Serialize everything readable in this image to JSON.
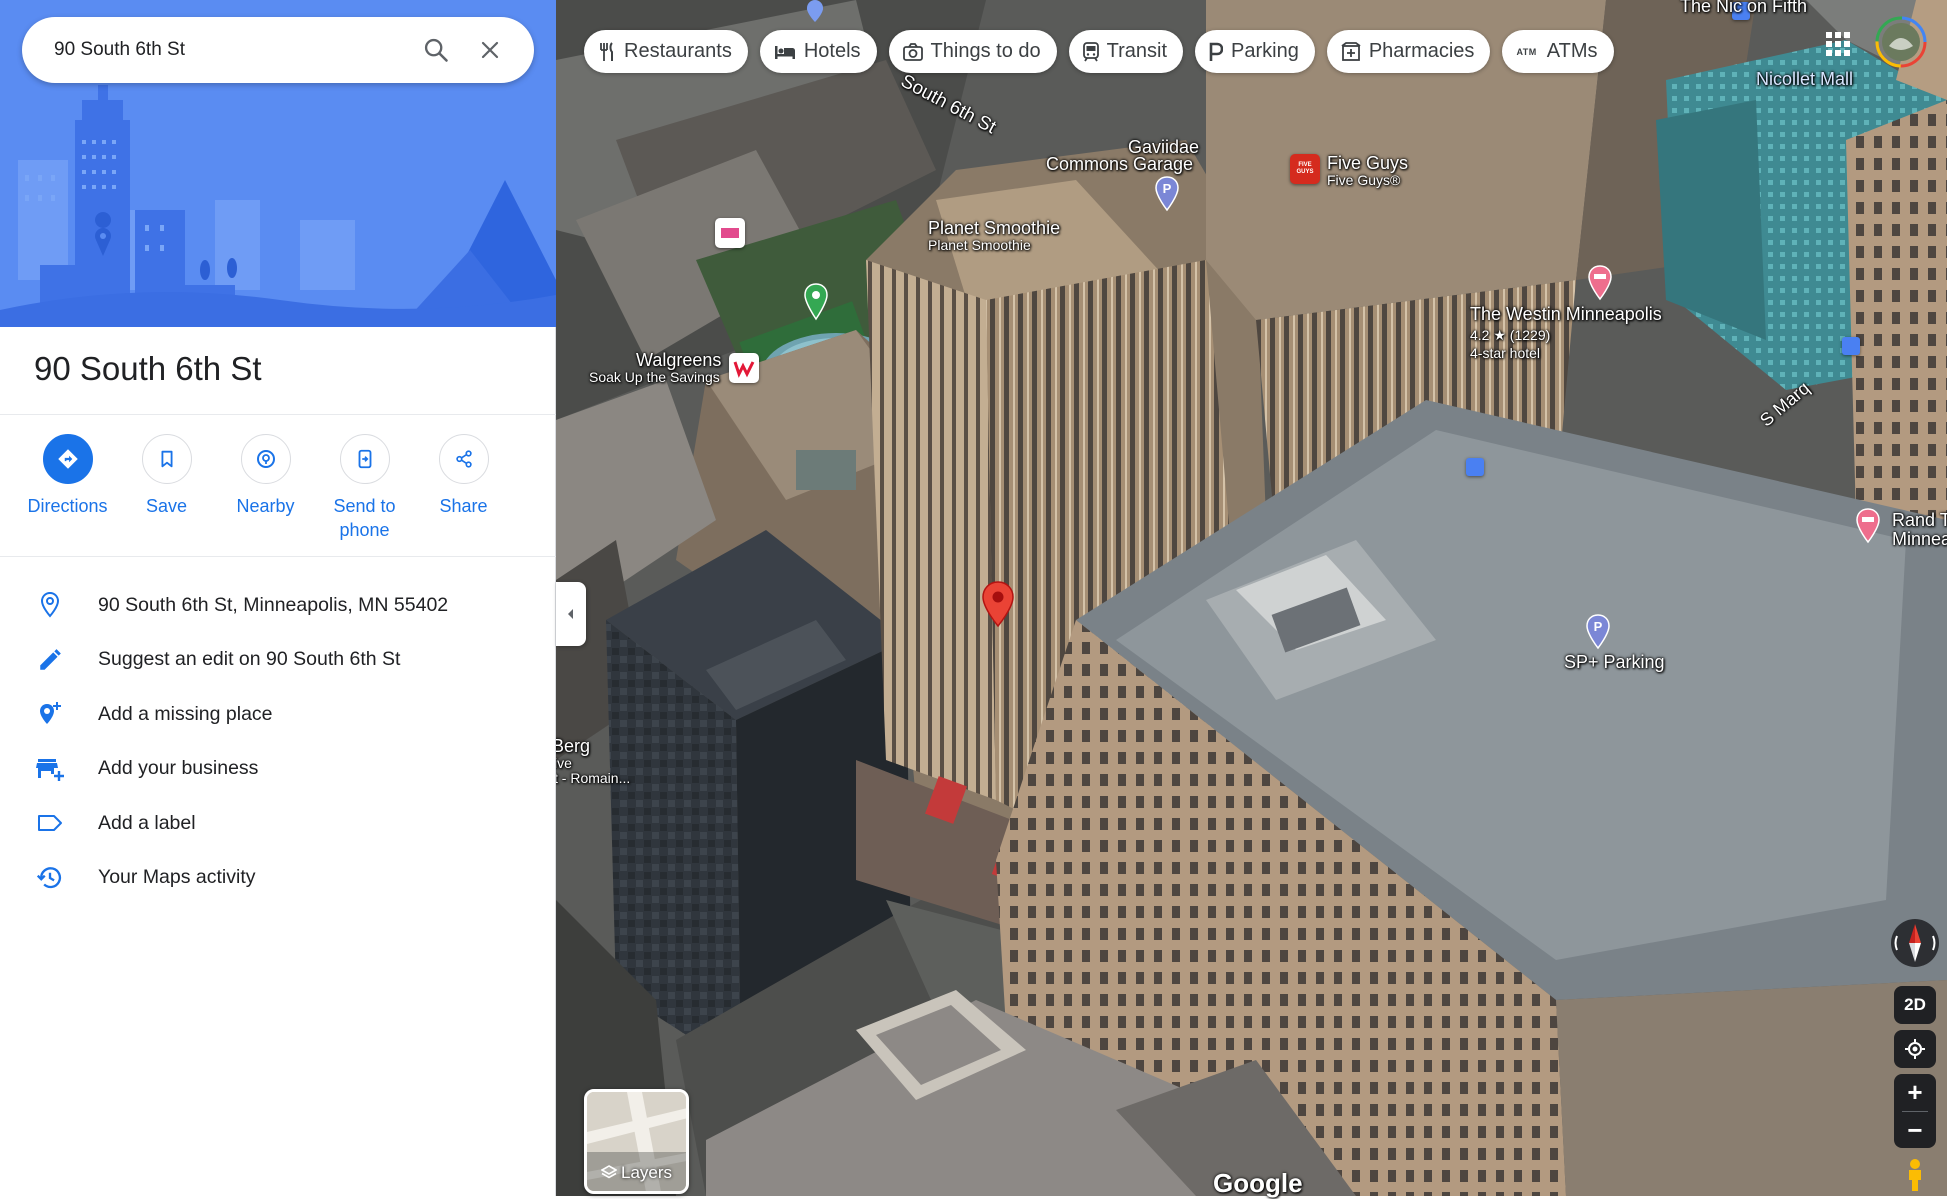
{
  "search": {
    "value": "90 South 6th St"
  },
  "place": {
    "title": "90 South 6th St"
  },
  "actions": [
    {
      "label": "Directions"
    },
    {
      "label": "Save"
    },
    {
      "label": "Nearby"
    },
    {
      "label": "Send to phone"
    },
    {
      "label": "Share"
    }
  ],
  "info": [
    {
      "text": "90 South 6th St, Minneapolis, MN 55402",
      "icon": "location-pin-icon"
    },
    {
      "text": "Suggest an edit on 90 South 6th St",
      "icon": "pencil-icon"
    },
    {
      "text": "Add a missing place",
      "icon": "add-place-icon"
    },
    {
      "text": "Add your business",
      "icon": "add-business-icon"
    },
    {
      "text": "Add a label",
      "icon": "label-icon"
    },
    {
      "text": "Your Maps activity",
      "icon": "history-icon"
    }
  ],
  "chips": [
    {
      "label": "Restaurants",
      "icon": "fork-knife-icon"
    },
    {
      "label": "Hotels",
      "icon": "bed-icon"
    },
    {
      "label": "Things to do",
      "icon": "camera-icon"
    },
    {
      "label": "Transit",
      "icon": "train-icon"
    },
    {
      "label": "Parking",
      "icon": "parking-icon"
    },
    {
      "label": "Pharmacies",
      "icon": "pharmacy-icon"
    },
    {
      "label": "ATMs",
      "icon": "atm-icon",
      "glyph": "ATM"
    }
  ],
  "map_labels": {
    "nic_on_fifth": "The Nic on Fifth",
    "nicollet_mall": "Nicollet Mall",
    "south_6th": "South 6th St",
    "gaviidae_1": "Gaviidae",
    "gaviidae_2": "Commons Garage",
    "five_guys": "Five Guys",
    "five_guys_sub": "Five Guys®",
    "five_guys_logo": "FIVE GUYS",
    "planet_smoothie": "Planet Smoothie",
    "planet_smoothie_sub": "Planet Smoothie",
    "walgreens": "Walgreens",
    "walgreens_sub": "Soak Up the Savings",
    "westin": "The Westin Minneapolis",
    "westin_rating": "4.2 ★ (1229)",
    "westin_type": "4-star hotel",
    "s_marq": "S Marq",
    "rand_1": "Rand T",
    "rand_2": "Minnea",
    "sp_parking": "SP+ Parking",
    "berg_1": "Berg",
    "berg_2": "ive",
    "berg_3": "t - Romain...",
    "google": "Google",
    "parking_letter": "P"
  },
  "controls": {
    "layers": "Layers",
    "view_2d": "2D",
    "zoom_in": "+",
    "zoom_out": "−"
  },
  "colors": {
    "accent": "#1a73e8",
    "pin_red": "#ea4335",
    "pin_green": "#34a853",
    "hero_bg": "#4a7ef0"
  }
}
